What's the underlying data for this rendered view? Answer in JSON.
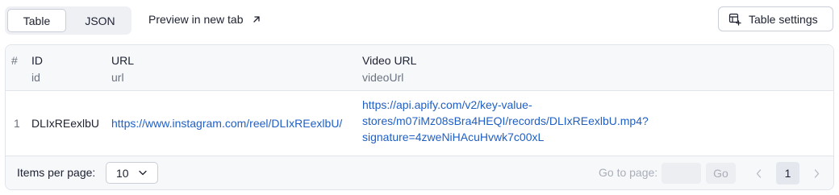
{
  "toolbar": {
    "view_tabs": [
      {
        "label": "Table",
        "active": true
      },
      {
        "label": "JSON",
        "active": false
      }
    ],
    "preview_link": "Preview in new tab",
    "settings_button": "Table settings"
  },
  "table": {
    "row_number_header": "#",
    "columns": [
      {
        "label": "ID",
        "key": "id"
      },
      {
        "label": "URL",
        "key": "url"
      },
      {
        "label": "Video URL",
        "key": "videoUrl"
      }
    ],
    "rows": [
      {
        "num": "1",
        "id": "DLIxREexlbU",
        "url": "https://www.instagram.com/reel/DLIxREexlbU/",
        "video_url_lines": [
          "https://api.apify.com/v2/key-value-",
          "stores/m07iMz08sBra4HEQI/records/DLIxREexlbU.mp4?",
          "signature=4zweNiHAcuHvwk7c00xL"
        ]
      }
    ]
  },
  "footer": {
    "items_per_page_label": "Items per page:",
    "items_per_page_value": "10",
    "go_to_page_label": "Go to page:",
    "go_to_page_value": "",
    "go_button": "Go",
    "current_page": "1"
  },
  "colors": {
    "link": "#1f5fc4",
    "border": "#e1e4ea",
    "header_bg": "#f7f8fa",
    "muted_text": "#6b7280"
  }
}
